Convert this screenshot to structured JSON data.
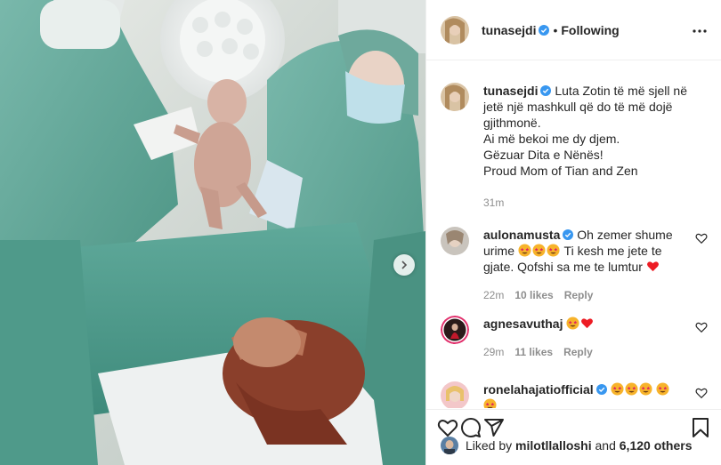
{
  "post": {
    "author": "tunasejdi",
    "follow_state": "Following",
    "separator": "•",
    "caption_lines": [
      "Luta Zotin të më sjell në jetë një mashkull që do të më dojë gjithmonë.",
      "Ai më bekoi me dy djem.",
      "Gëzuar Dita e Nënës!",
      "Proud Mom of Tian and Zen"
    ],
    "time": "31m"
  },
  "comments": [
    {
      "user": "aulonamusta",
      "text_a": "Oh zemer shume urime",
      "text_b": "Ti kesh me jete te gjate. Qofshi sa me te lumtur",
      "time": "22m",
      "likes": "10 likes",
      "reply": "Reply"
    },
    {
      "user": "agnesavuthaj",
      "time": "29m",
      "likes": "11 likes",
      "reply": "Reply"
    },
    {
      "user": "ronelahajatiofficial"
    }
  ],
  "likes_bar": {
    "prefix": "Liked by",
    "user": "milotllalloshi",
    "middle": "and",
    "count": "6,120 others"
  },
  "icons": {
    "verified": "verified-badge-icon",
    "more": "more-options-icon",
    "heart": "heart-icon",
    "comment": "comment-icon",
    "share": "share-icon",
    "save": "bookmark-icon",
    "next": "chevron-right-icon",
    "emoji_star_eyes": "star-struck-emoji",
    "emoji_heart": "red-heart-emoji"
  },
  "colors": {
    "verified_blue": "#3897f0",
    "meta_gray": "#8e8e8e",
    "text": "#262626",
    "heart_red": "#ed1c24",
    "emoji_yellow": "#f7b32b"
  }
}
